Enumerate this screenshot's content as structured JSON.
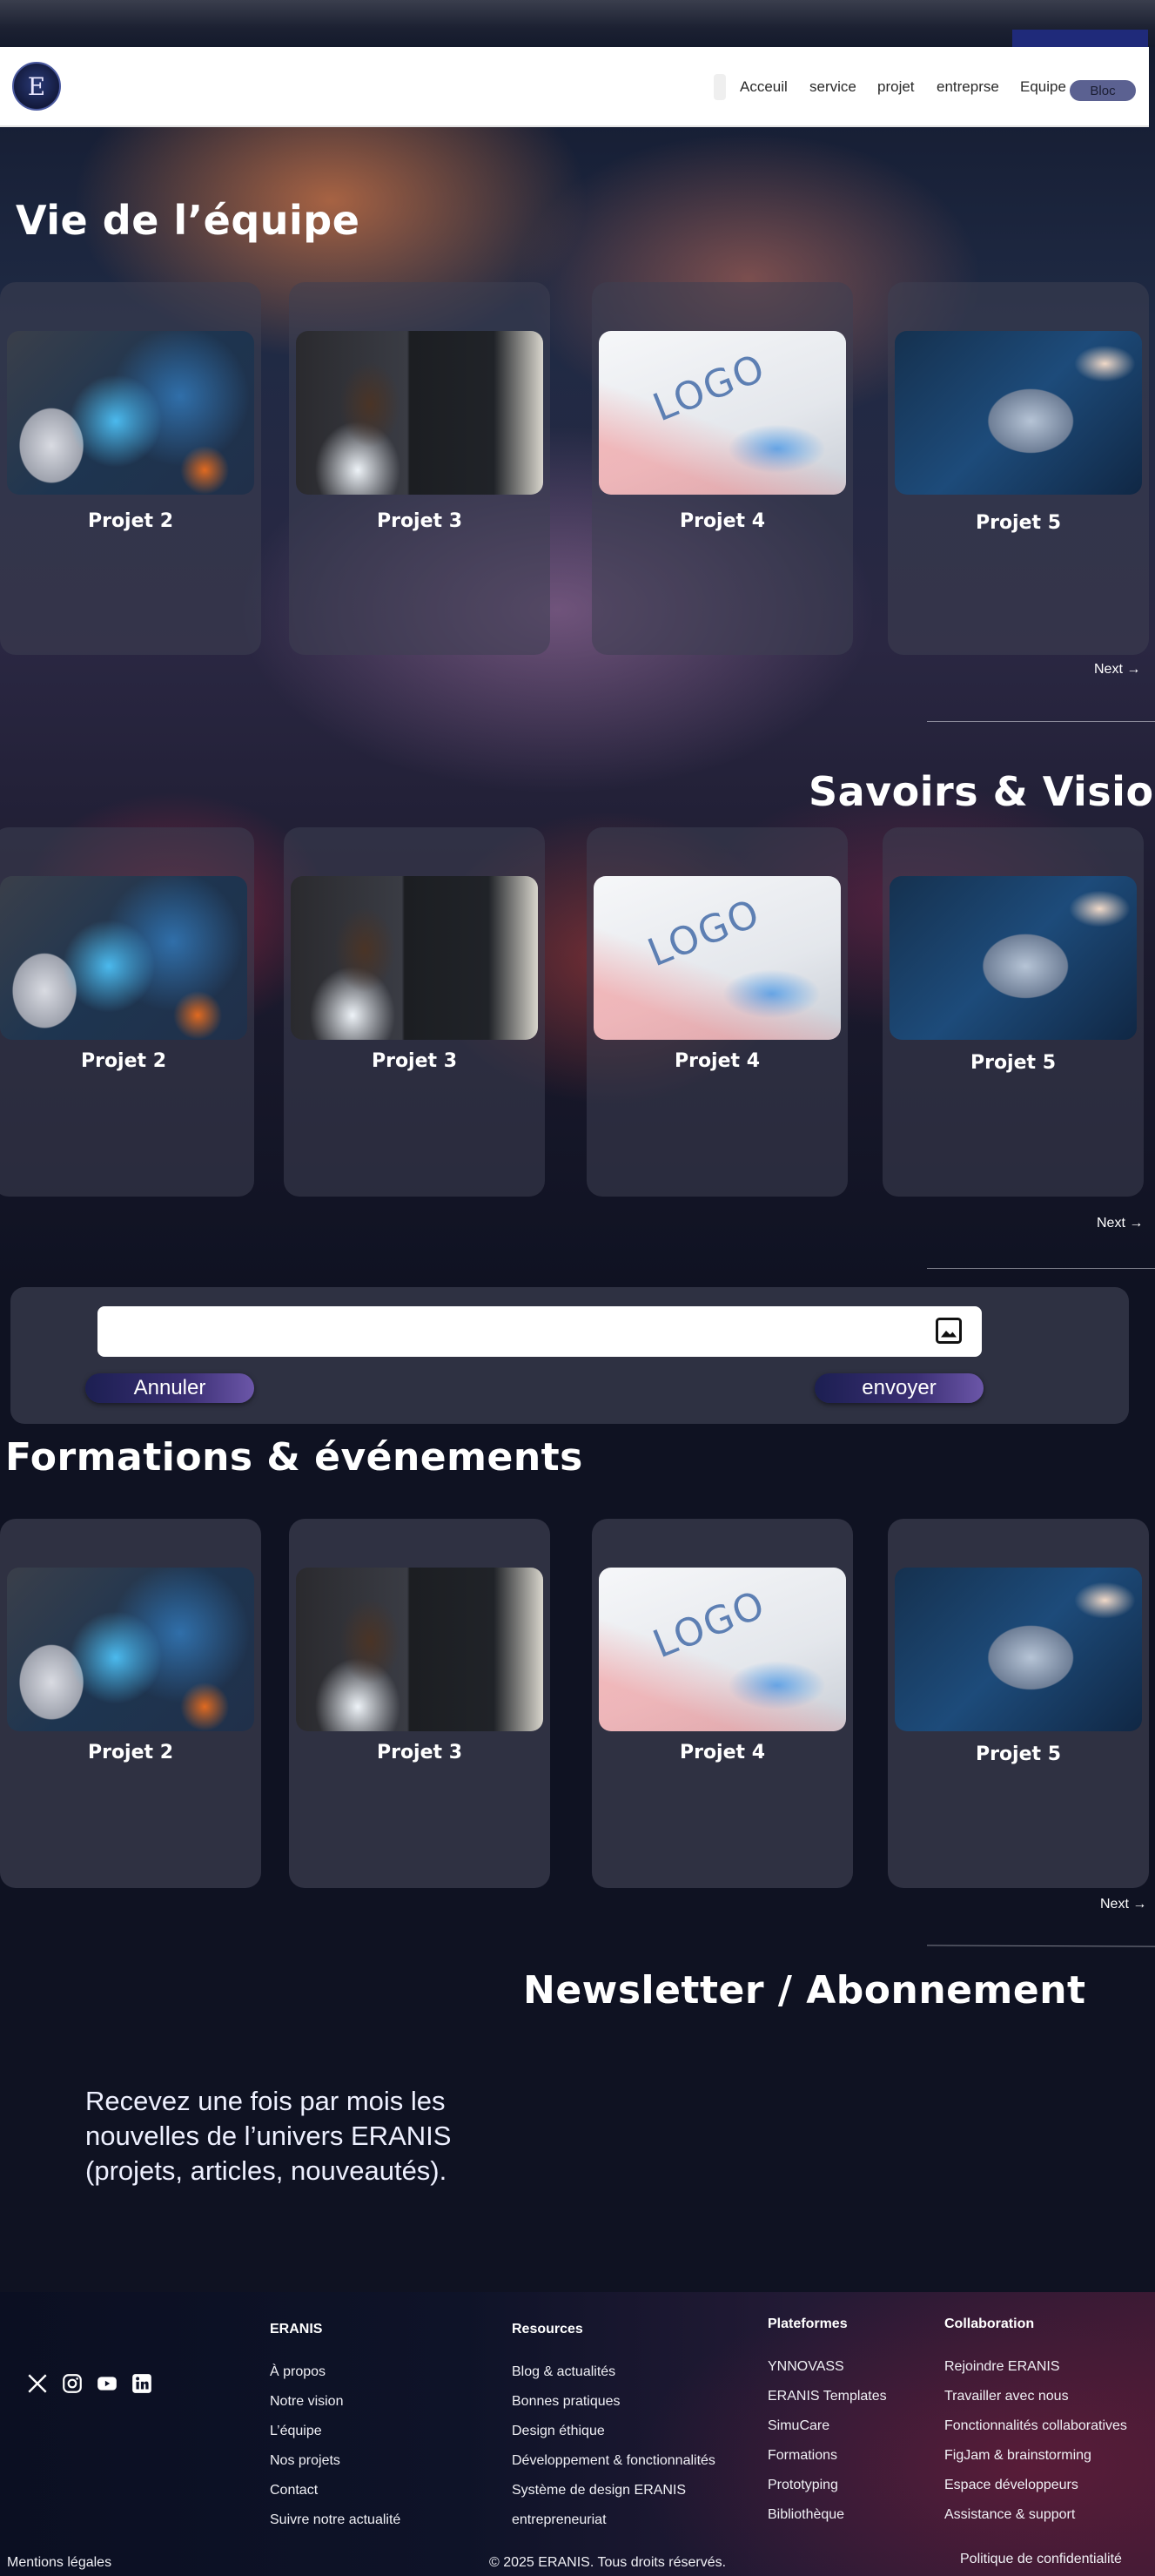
{
  "header": {
    "logo_letter": "E",
    "nav": [
      "Acceuil",
      "service",
      "projet",
      "entreprse",
      "Equipe"
    ],
    "bloc_button": "Bloc"
  },
  "sections": {
    "team": {
      "title": "Vie de l’équipe",
      "cards": [
        "Projet 2",
        "Projet 3",
        "Projet 4",
        "Projet 5"
      ],
      "next": "Next"
    },
    "knowledge": {
      "title": "Savoirs & Vision",
      "cards": [
        "Projet 2",
        "Projet 3",
        "Projet 4",
        "Projet 5"
      ],
      "next": "Next"
    },
    "events": {
      "title": "Formations & événements",
      "cards": [
        "Projet 2",
        "Projet 3",
        "Projet 4",
        "Projet 5"
      ],
      "next": "Next"
    }
  },
  "form": {
    "input_value": "",
    "cancel_label": "Annuler",
    "send_label": "envoyer"
  },
  "newsletter": {
    "title": "Newsletter / Abonnement",
    "text": "Recevez une fois par mois les nouvelles de l’univers ERANIS (projets, articles, nouveautés)."
  },
  "thumb_logo_text": "LOGO",
  "footer": {
    "social_icons": [
      "x-icon",
      "instagram-icon",
      "youtube-icon",
      "linkedin-icon"
    ],
    "columns": [
      {
        "title": "ERANIS",
        "links": [
          "À propos",
          "Notre vision",
          "L’équipe",
          "Nos projets",
          "Contact",
          "Suivre notre actualité"
        ]
      },
      {
        "title": "Resources",
        "links": [
          "Blog & actualités",
          "Bonnes pratiques",
          "Design éthique",
          "Développement & fonctionnalités",
          "Système de design ERANIS",
          "entrepreneuriat"
        ]
      },
      {
        "title": "Plateformes",
        "links": [
          "YNNOVASS",
          "ERANIS Templates",
          "SimuCare",
          "Formations",
          "Prototyping",
          "Bibliothèque"
        ]
      },
      {
        "title": "Collaboration",
        "links": [
          "Rejoindre ERANIS",
          "Travailler avec nous",
          "Fonctionnalités collaboratives",
          "FigJam & brainstorming",
          "Espace développeurs",
          "Assistance & support"
        ]
      }
    ],
    "legal": "Mentions légales",
    "copyright": "© 2025 ERANIS. Tous droits réservés.",
    "privacy": "Politique de confidentialité"
  },
  "colors": {
    "page_bg": "#0f1222",
    "card_bg": "#2f3142",
    "button_gradient_start": "#1c1f52",
    "button_gradient_end": "#6b56a8",
    "bloc_button": "#5b6191"
  }
}
